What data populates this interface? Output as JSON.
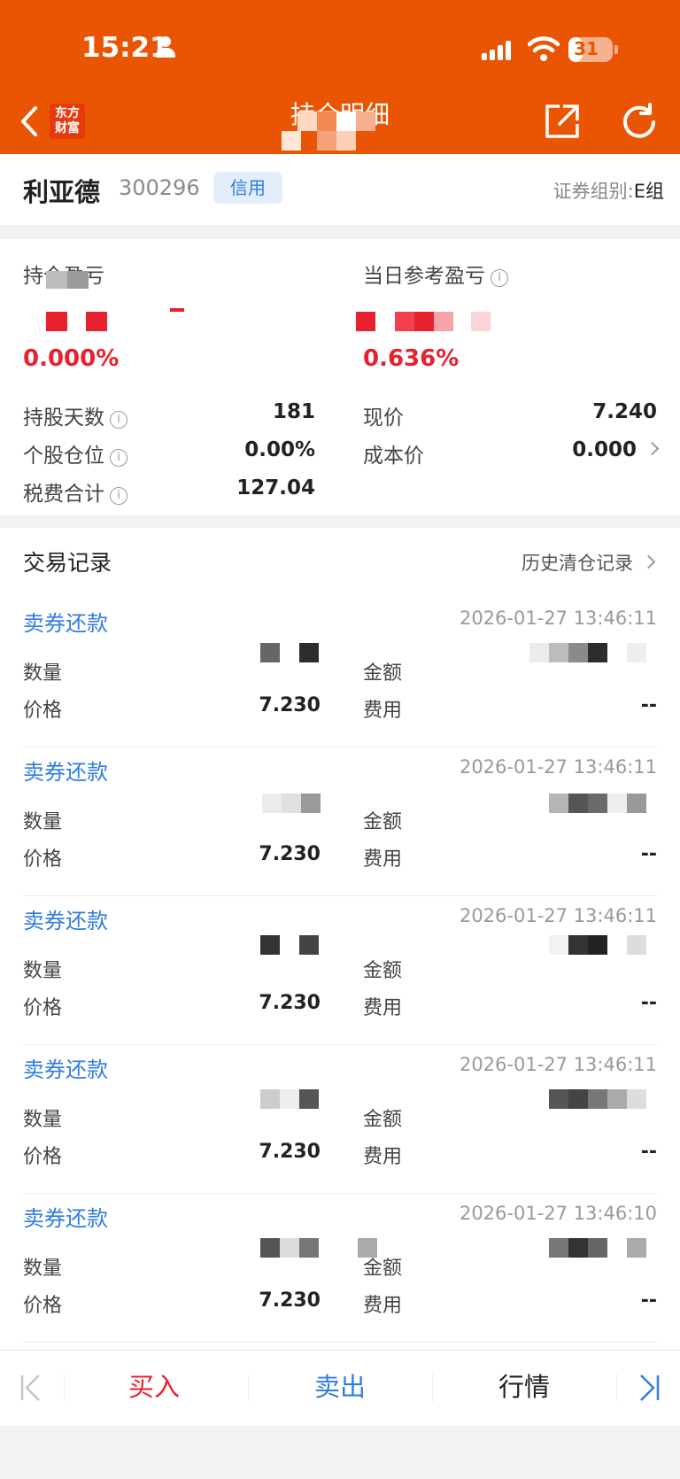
{
  "status_bar": {
    "time": "15:21",
    "battery": "31",
    "battery_level": 0.31
  },
  "nav": {
    "logo_line1": "东方",
    "logo_line2": "财富",
    "title": "持仓明细"
  },
  "stock": {
    "name": "利亚德",
    "code": "300296",
    "badge": "信用",
    "group_label": "证券组别:",
    "group_value": "E组"
  },
  "position": {
    "holding_pl_label": "持仓盈亏",
    "holding_pl_pct": "0.000%",
    "daily_pl_label": "当日参考盈亏",
    "daily_pl_pct": "0.636%",
    "info_icon": "ⓘ",
    "rows": [
      {
        "label": "持股天数",
        "value": "181"
      },
      {
        "label": "个股仓位",
        "value": "0.00%"
      },
      {
        "label": "税费合计",
        "value": "127.04"
      }
    ],
    "right_rows": [
      {
        "label": "现价",
        "value": "7.240"
      },
      {
        "label": "成本价",
        "value": "0.000"
      }
    ]
  },
  "trades": {
    "title": "交易记录",
    "history_link": "历史清仓记录",
    "labels": {
      "qty": "数量",
      "amount": "金额",
      "price": "价格",
      "fee": "费用"
    },
    "items": [
      {
        "type": "卖券还款",
        "time": "2026-01-27 13:46:11",
        "price": "7.230",
        "fee": "--"
      },
      {
        "type": "卖券还款",
        "time": "2026-01-27 13:46:11",
        "price": "7.230",
        "fee": "--"
      },
      {
        "type": "卖券还款",
        "time": "2026-01-27 13:46:11",
        "price": "7.230",
        "fee": "--"
      },
      {
        "type": "卖券还款",
        "time": "2026-01-27 13:46:11",
        "price": "7.230",
        "fee": "--"
      },
      {
        "type": "卖券还款",
        "time": "2026-01-27 13:46:10",
        "price": "7.230",
        "fee": "--"
      }
    ]
  },
  "bottom_bar": {
    "buy": "买入",
    "sell": "卖出",
    "quote": "行情"
  },
  "colors": {
    "brand": "#ea5504",
    "profit_red": "#e8212e",
    "link_blue": "#2f7de1",
    "buy_red": "#e8212e",
    "sell_blue": "#2f7de1"
  }
}
